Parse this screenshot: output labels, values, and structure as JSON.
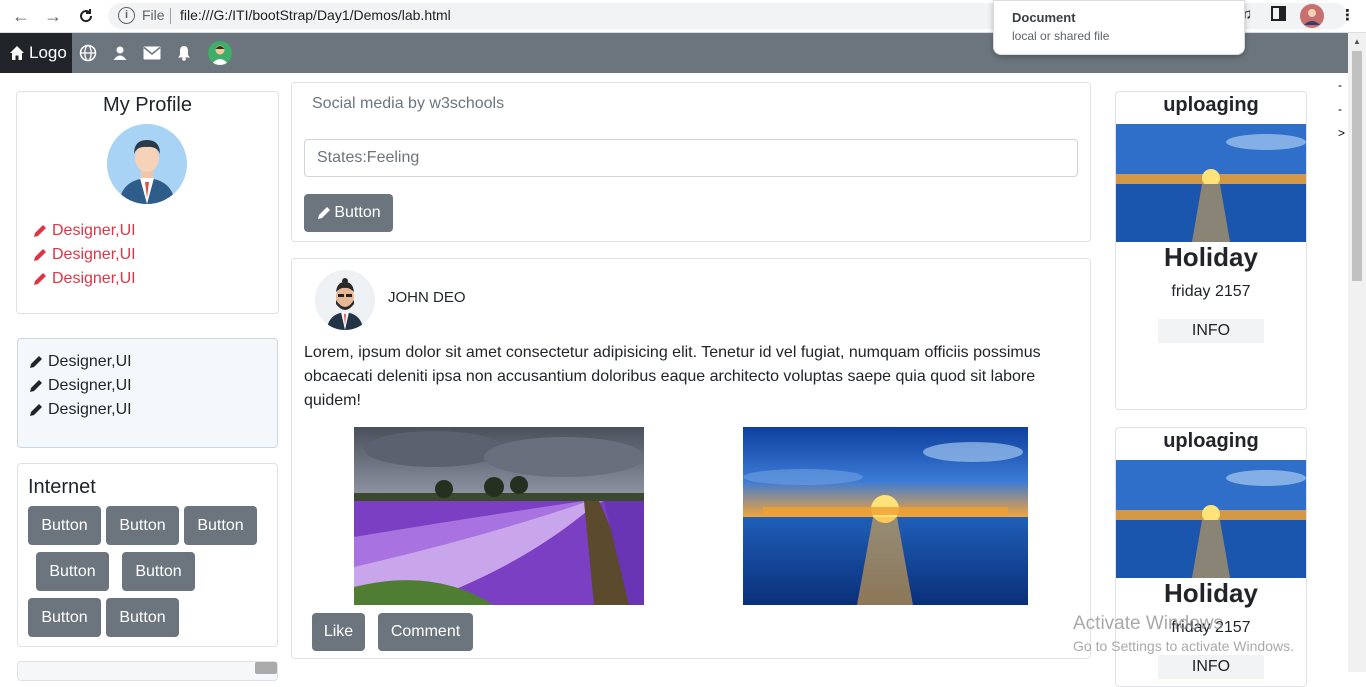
{
  "browser": {
    "file_label": "File",
    "url": "file:///G:/ITI/bootStrap/Day1/Demos/lab.html",
    "tooltip_title": "Document",
    "tooltip_subtitle": "local or shared file"
  },
  "navbar": {
    "logo": "Logo",
    "icons": [
      "globe-icon",
      "user-icon",
      "mail-icon",
      "bell-icon",
      "avatar"
    ]
  },
  "profile": {
    "title": "My Profile",
    "skills": [
      "Designer,UI",
      "Designer,UI",
      "Designer,UI"
    ]
  },
  "skills_box": {
    "items": [
      "Designer,UI",
      "Designer,UI",
      "Designer,UI"
    ]
  },
  "internet": {
    "title": "Internet",
    "buttons": [
      "Button",
      "Button",
      "Button",
      "Button",
      "Button",
      "Button",
      "Button"
    ]
  },
  "composer": {
    "header": "Social media by w3schools",
    "input_value": "States:Feeling",
    "button_label": "Button"
  },
  "post": {
    "author": "JOHN DEO",
    "body": "Lorem, ipsum dolor sit amet consectetur adipisicing elit. Tenetur id vel fugiat, numquam officiis possimus obcaecati deleniti ipsa non accusantium doloribus eaque architecto voluptas saepe quia quod sit labore quidem!",
    "like_label": "Like",
    "comment_label": "Comment"
  },
  "right_cards": [
    {
      "title": "uploaging",
      "heading": "Holiday",
      "date": "friday 2157",
      "info": "INFO"
    },
    {
      "title": "uploaging",
      "heading": "Holiday",
      "date": "friday 2157",
      "info": "INFO"
    }
  ],
  "side_marks": [
    "-",
    "-",
    ">"
  ],
  "watermark": {
    "line1": "Activate Windows",
    "line2": "Go to Settings to activate Windows."
  },
  "colors": {
    "navbar": "#6c757d",
    "logo_bg": "#212529",
    "skill_red": "#dc3545",
    "button": "#6c757d"
  }
}
